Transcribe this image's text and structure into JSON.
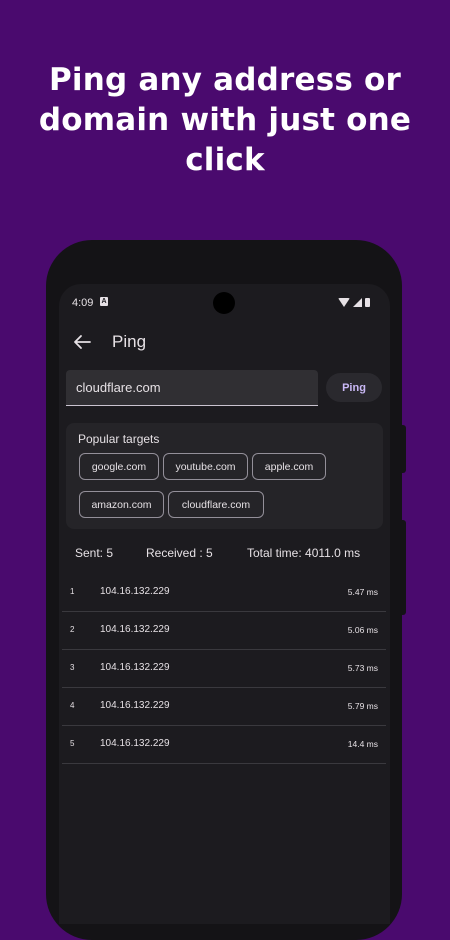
{
  "headline": [
    "Ping any address or",
    "domain with just one",
    "click"
  ],
  "status_bar": {
    "time": "4:09",
    "notification_icon": "A"
  },
  "app_bar": {
    "back_icon": "arrow-left-icon",
    "title": "Ping"
  },
  "input": {
    "value": "cloudflare.com",
    "placeholder": ""
  },
  "ping_button": {
    "label": "Ping"
  },
  "popular_targets": {
    "title": "Popular targets",
    "chips": [
      "google.com",
      "youtube.com",
      "apple.com",
      "amazon.com",
      "cloudflare.com"
    ]
  },
  "stats": {
    "sent": "Sent: 5",
    "received": "Received : 5",
    "total_time": "Total time: 4011.0 ms"
  },
  "results": [
    {
      "index": "1",
      "ip": "104.16.132.229",
      "time": "5.47 ms"
    },
    {
      "index": "2",
      "ip": "104.16.132.229",
      "time": "5.06 ms"
    },
    {
      "index": "3",
      "ip": "104.16.132.229",
      "time": "5.73 ms"
    },
    {
      "index": "4",
      "ip": "104.16.132.229",
      "time": "5.79 ms"
    },
    {
      "index": "5",
      "ip": "104.16.132.229",
      "time": "14.4 ms"
    }
  ],
  "colors": {
    "background": "#4a0a6e",
    "surface": "#1c1b1f",
    "accent": "#c9b8f5"
  }
}
